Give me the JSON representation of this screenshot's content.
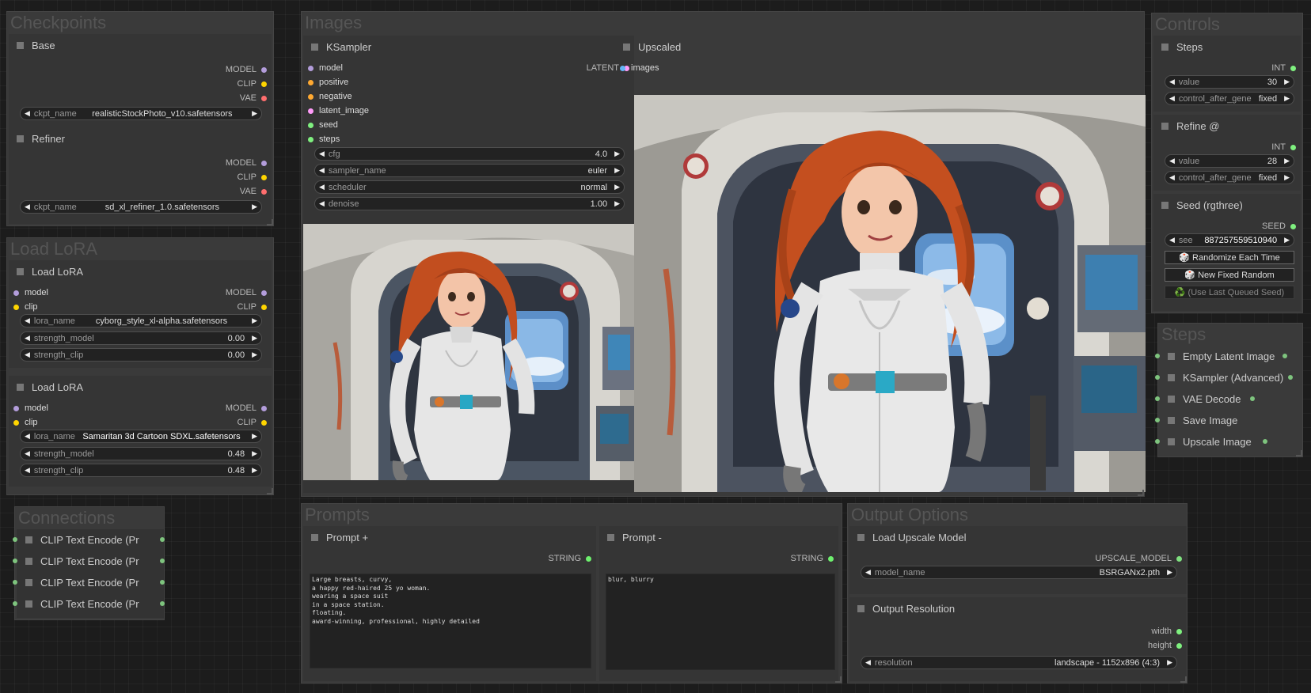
{
  "colors": {
    "model": "#b39ddb",
    "clip": "#ffd500",
    "vae": "#ff6e6e",
    "latent": "#ff9cf9",
    "image": "#64b5f6",
    "conditioning": "#ffa931",
    "int": "#7ff07f",
    "string": "#6ef06e",
    "upscale_model": "#7fe07f"
  },
  "checkpoints": {
    "group_title": "Checkpoints",
    "base": {
      "title": "Base",
      "outputs": [
        "MODEL",
        "CLIP",
        "VAE"
      ],
      "widget_label": "ckpt_name",
      "widget_value": "realisticStockPhoto_v10.safetensors"
    },
    "refiner": {
      "title": "Refiner",
      "outputs": [
        "MODEL",
        "CLIP",
        "VAE"
      ],
      "widget_label": "ckpt_name",
      "widget_value": "sd_xl_refiner_1.0.safetensors"
    }
  },
  "lora": {
    "group_title": "Load LoRA",
    "nodes": [
      {
        "title": "Load LoRA",
        "inputs": [
          "model",
          "clip"
        ],
        "outputs": [
          "MODEL",
          "CLIP"
        ],
        "widgets": [
          {
            "label": "lora_name",
            "value": "cyborg_style_xl-alpha.safetensors"
          },
          {
            "label": "strength_model",
            "value": "0.00"
          },
          {
            "label": "strength_clip",
            "value": "0.00"
          }
        ]
      },
      {
        "title": "Load LoRA",
        "inputs": [
          "model",
          "clip"
        ],
        "outputs": [
          "MODEL",
          "CLIP"
        ],
        "widgets": [
          {
            "label": "lora_name",
            "value": "Samaritan 3d Cartoon SDXL.safetensors"
          },
          {
            "label": "strength_model",
            "value": "0.48"
          },
          {
            "label": "strength_clip",
            "value": "0.48"
          }
        ]
      }
    ]
  },
  "connections": {
    "group_title": "Connections",
    "items": [
      "CLIP Text Encode (Pr",
      "CLIP Text Encode (Pr",
      "CLIP Text Encode (Pr",
      "CLIP Text Encode (Pr"
    ]
  },
  "images": {
    "group_title": "Images",
    "ksampler": {
      "title": "KSampler",
      "inputs": [
        "model",
        "positive",
        "negative",
        "latent_image",
        "seed",
        "steps"
      ],
      "output": "LATENT",
      "widgets": [
        {
          "label": "cfg",
          "value": "4.0"
        },
        {
          "label": "sampler_name",
          "value": "euler"
        },
        {
          "label": "scheduler",
          "value": "normal"
        },
        {
          "label": "denoise",
          "value": "1.00"
        }
      ]
    },
    "upscaled": {
      "title": "Upscaled",
      "input": "images"
    }
  },
  "controls": {
    "group_title": "Controls",
    "steps": {
      "title": "Steps",
      "output": "INT",
      "widgets": [
        {
          "label": "value",
          "value": "30"
        },
        {
          "label": "control_after_gene",
          "value": "fixed"
        }
      ]
    },
    "refine": {
      "title": "Refine @",
      "output": "INT",
      "widgets": [
        {
          "label": "value",
          "value": "28"
        },
        {
          "label": "control_after_gene",
          "value": "fixed"
        }
      ]
    },
    "seed": {
      "title": "Seed (rgthree)",
      "output": "SEED",
      "widget_label": "see",
      "widget_value": "887257559510940",
      "buttons": [
        "🎲 Randomize Each Time",
        "🎲 New Fixed Random",
        "♻️ (Use Last Queued Seed)"
      ]
    }
  },
  "steps_group": {
    "group_title": "Steps",
    "items": [
      "Empty Latent Image",
      "KSampler (Advanced)",
      "VAE Decode",
      "Save Image",
      "Upscale Image"
    ]
  },
  "prompts": {
    "group_title": "Prompts",
    "positive": {
      "title": "Prompt +",
      "output": "STRING",
      "text": "Large breasts, curvy,\na happy red-haired 25 yo woman.\nwearing a space suit\nin a space station.\nfloating.\naward-winning, professional, highly detailed"
    },
    "negative": {
      "title": "Prompt -",
      "output": "STRING",
      "text": "blur, blurry"
    }
  },
  "output_options": {
    "group_title": "Output Options",
    "upscale_model": {
      "title": "Load Upscale Model",
      "output": "UPSCALE_MODEL",
      "widget_label": "model_name",
      "widget_value": "BSRGANx2.pth"
    },
    "resolution": {
      "title": "Output Resolution",
      "outputs": [
        "width",
        "height"
      ],
      "widget_label": "resolution",
      "widget_value": "landscape - 1152x896 (4:3)"
    }
  }
}
